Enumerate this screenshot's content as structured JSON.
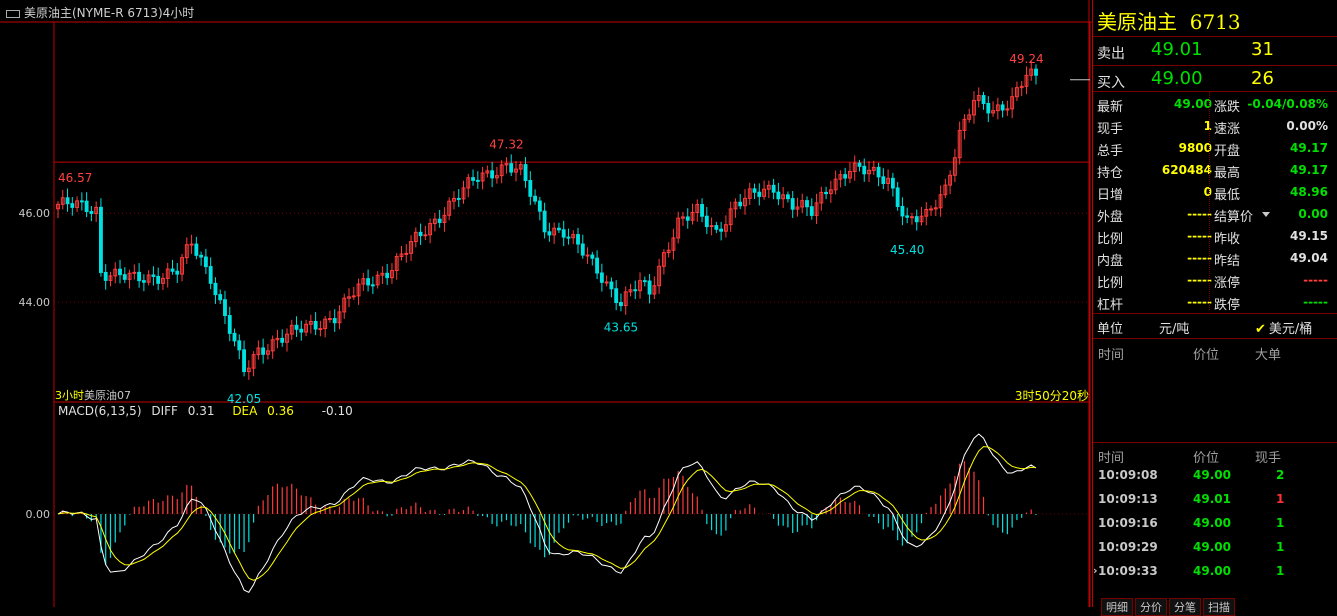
{
  "window": {
    "title": "美原油主(NYME-R 6713)4小时"
  },
  "chart_data": {
    "type": "candlestick",
    "ylim": [
      41.8,
      50.3
    ],
    "y_ticks": [
      46.0,
      44.0
    ],
    "y_tick_labels": [
      "46.00",
      "44.00"
    ],
    "hline_last_price": 49.0,
    "hline_ref": 47.15,
    "annotations": [
      {
        "text": "46.57",
        "value": 46.57,
        "kind": "high",
        "index": 0
      },
      {
        "text": "42.05",
        "value": 42.05,
        "kind": "low",
        "index": 39
      },
      {
        "text": "47.32",
        "value": 47.32,
        "kind": "high",
        "index": 94
      },
      {
        "text": "43.65",
        "value": 43.65,
        "kind": "low",
        "index": 118
      },
      {
        "text": "45.40",
        "value": 45.4,
        "kind": "low",
        "index": 178
      },
      {
        "text": "49.24",
        "value": 49.24,
        "kind": "high",
        "index": 203
      }
    ],
    "contract_label": "美原油07",
    "period_label": "3小时",
    "countdown": "3时50分20秒",
    "macd": {
      "label": "MACD(6,13,5)",
      "diff_label": "DIFF",
      "diff_value": "0.31",
      "dea_label": "DEA",
      "dea_value": "0.36",
      "macd_value": "-0.10",
      "zero_label": "0.00"
    },
    "close_keypoints": [
      [
        0,
        46.2
      ],
      [
        8,
        46.1
      ],
      [
        9,
        44.7
      ],
      [
        16,
        44.5
      ],
      [
        25,
        44.7
      ],
      [
        28,
        45.3
      ],
      [
        32,
        44.6
      ],
      [
        36,
        43.4
      ],
      [
        39,
        42.4
      ],
      [
        42,
        42.9
      ],
      [
        46,
        43.2
      ],
      [
        52,
        43.4
      ],
      [
        58,
        43.7
      ],
      [
        63,
        44.3
      ],
      [
        70,
        44.8
      ],
      [
        76,
        45.5
      ],
      [
        82,
        46.2
      ],
      [
        88,
        46.8
      ],
      [
        94,
        47.1
      ],
      [
        97,
        46.9
      ],
      [
        100,
        46.2
      ],
      [
        102,
        45.7
      ],
      [
        106,
        45.6
      ],
      [
        110,
        45.1
      ],
      [
        114,
        44.6
      ],
      [
        118,
        44.0
      ],
      [
        122,
        44.4
      ],
      [
        124,
        44.2
      ],
      [
        127,
        45.1
      ],
      [
        130,
        45.8
      ],
      [
        134,
        46.0
      ],
      [
        138,
        45.6
      ],
      [
        142,
        46.2
      ],
      [
        146,
        46.4
      ],
      [
        150,
        46.6
      ],
      [
        154,
        46.2
      ],
      [
        158,
        46.0
      ],
      [
        162,
        46.7
      ],
      [
        166,
        47.0
      ],
      [
        170,
        46.9
      ],
      [
        174,
        46.8
      ],
      [
        176,
        46.3
      ],
      [
        178,
        45.8
      ],
      [
        182,
        45.9
      ],
      [
        186,
        46.6
      ],
      [
        189,
        47.8
      ],
      [
        192,
        48.5
      ],
      [
        196,
        48.3
      ],
      [
        200,
        48.6
      ],
      [
        203,
        49.1
      ],
      [
        205,
        49.0
      ]
    ],
    "wick_pct": 0.14
  },
  "quote": {
    "title": "美原油主",
    "code": "6713",
    "ask_label": "卖出",
    "ask_price": "49.01",
    "ask_vol": "31",
    "bid_label": "买入",
    "bid_price": "49.00",
    "bid_vol": "26",
    "rows": [
      {
        "l1": "最新",
        "v1": "49.00",
        "c1": "#00e000",
        "l2": "涨跌",
        "v2": "-0.04/0.08%",
        "c2": "#00e000"
      },
      {
        "l1": "现手",
        "v1": "1",
        "c1": "#ffff00",
        "l2": "速涨",
        "v2": "0.00%",
        "c2": "#e0e0e0"
      },
      {
        "l1": "总手",
        "v1": "9800",
        "c1": "#ffff00",
        "l2": "开盘",
        "v2": "49.17",
        "c2": "#00e000"
      },
      {
        "l1": "持仓",
        "v1": "620484",
        "c1": "#ffff00",
        "l2": "最高",
        "v2": "49.17",
        "c2": "#00e000"
      },
      {
        "l1": "日增",
        "v1": "0",
        "c1": "#ffff00",
        "l2": "最低",
        "v2": "48.96",
        "c2": "#00e000"
      },
      {
        "l1": "外盘",
        "v1": "-----",
        "c1": "#ffff00",
        "l2": "结算价",
        "v2": "0.00",
        "c2": "#00e000"
      },
      {
        "l1": "比例",
        "v1": "-----",
        "c1": "#ffff00",
        "l2": "昨收",
        "v2": "49.15",
        "c2": "#e0e0e0"
      },
      {
        "l1": "内盘",
        "v1": "-----",
        "c1": "#ffff00",
        "l2": "昨结",
        "v2": "49.04",
        "c2": "#e0e0e0"
      },
      {
        "l1": "比例",
        "v1": "-----",
        "c1": "#ffff00",
        "l2": "涨停",
        "v2": "-----",
        "c2": "#ff4040"
      },
      {
        "l1": "杠杆",
        "v1": "-----",
        "c1": "#ffff00",
        "l2": "跌停",
        "v2": "-----",
        "c2": "#00e000"
      }
    ],
    "unit_label": "单位",
    "unit_value": "元/吨",
    "unit_alt": "美元/桶",
    "bigorder_cols": [
      "时间",
      "价位",
      "大单"
    ],
    "tick_cols": [
      "时间",
      "价位",
      "现手"
    ],
    "ticks": [
      {
        "time": "10:09:08",
        "price": "49.00",
        "vol": "2",
        "vc": "#00e000"
      },
      {
        "time": "10:09:13",
        "price": "49.01",
        "vol": "1",
        "vc": "#ff3030"
      },
      {
        "time": "10:09:16",
        "price": "49.00",
        "vol": "1",
        "vc": "#00e000"
      },
      {
        "time": "10:09:29",
        "price": "49.00",
        "vol": "1",
        "vc": "#00e000"
      },
      {
        "time": "10:09:33",
        "price": "49.00",
        "vol": "1",
        "vc": "#00e000"
      }
    ],
    "bottom_tabs": [
      "明细",
      "分价",
      "分笔",
      "扫描"
    ]
  },
  "colors": {
    "up": "#ff3b3b",
    "down": "#00e0e0",
    "frame": "#c00000",
    "diff_line": "#ffffff",
    "dea_line": "#ffff00"
  }
}
